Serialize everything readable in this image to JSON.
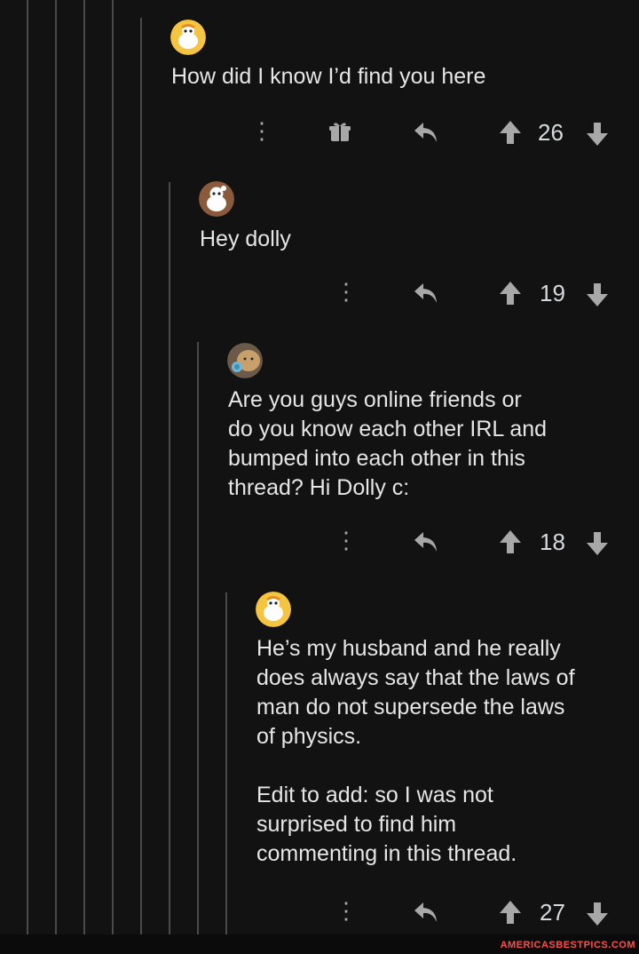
{
  "comments": [
    {
      "text": "How did I know I’d find you here",
      "score": "26",
      "avatar": "snoo-avatar-orange-cap",
      "has_award": true
    },
    {
      "text": "Hey dolly",
      "score": "19",
      "avatar": "snoo-avatar-brown",
      "has_award": false
    },
    {
      "text": "Are you guys online friends or\ndo you know each other IRL and\nbumped into each other in this\nthread? Hi Dolly c:",
      "score": "18",
      "avatar": "cat-photo-avatar",
      "has_award": false
    },
    {
      "text": "He’s my husband and he really\ndoes always say that the laws of\nman do not supersede the laws\nof physics.\n\nEdit to add: so I was not\nsurprised to find him\ncommenting in this thread.",
      "score": "27",
      "avatar": "snoo-avatar-orange-cap",
      "has_award": false
    }
  ],
  "watermark": "AMERICASBESTPICS.COM",
  "colors": {
    "background": "#121212",
    "thread_line": "#4a4a4c",
    "text": "#e6e6e6",
    "icon": "#a8a8a8",
    "watermark": "#ff4d4d"
  }
}
